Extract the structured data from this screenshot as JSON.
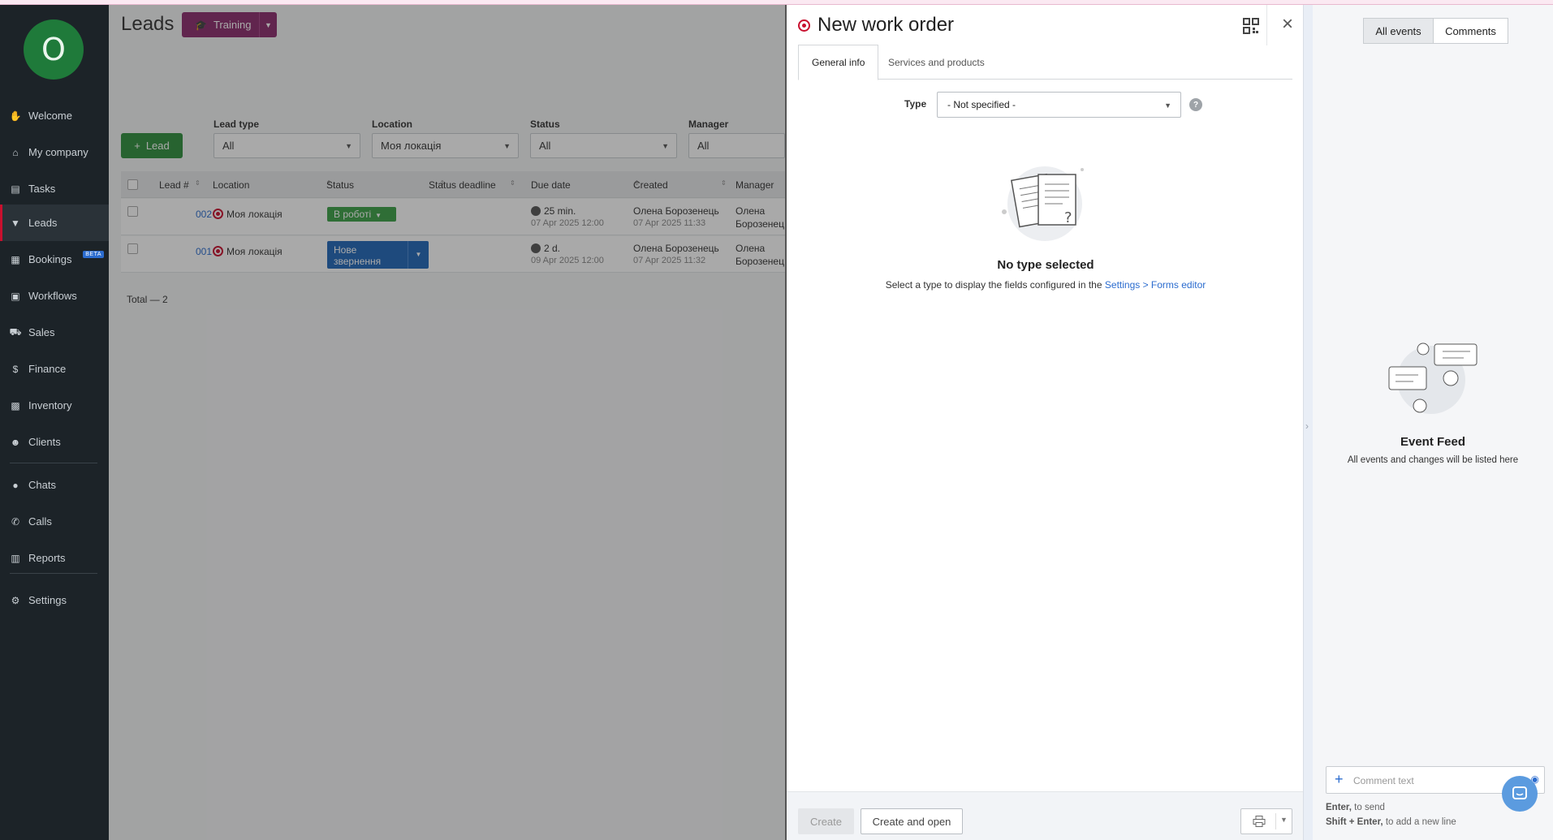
{
  "sidebar": {
    "avatar_letter": "O",
    "items": [
      {
        "label": "Welcome",
        "icon": "wave-hand-icon"
      },
      {
        "label": "My company",
        "icon": "home-icon"
      },
      {
        "label": "Tasks",
        "icon": "clipboard-icon"
      },
      {
        "label": "Leads",
        "icon": "funnel-icon"
      },
      {
        "label": "Bookings",
        "icon": "calendar-icon",
        "badge": "BETA"
      },
      {
        "label": "Workflows",
        "icon": "board-icon"
      },
      {
        "label": "Sales",
        "icon": "cart-icon"
      },
      {
        "label": "Finance",
        "icon": "dollar-icon"
      },
      {
        "label": "Inventory",
        "icon": "boxes-icon"
      },
      {
        "label": "Clients",
        "icon": "users-icon"
      },
      {
        "label": "Chats",
        "icon": "chat-icon"
      },
      {
        "label": "Calls",
        "icon": "phone-icon"
      },
      {
        "label": "Reports",
        "icon": "report-icon"
      },
      {
        "label": "Settings",
        "icon": "gear-icon"
      }
    ]
  },
  "leads": {
    "title": "Leads",
    "training_label": "Training",
    "add_lead_label": "Lead",
    "filters": [
      {
        "label": "Lead type",
        "value": "All"
      },
      {
        "label": "Location",
        "value": "Моя локація"
      },
      {
        "label": "Status",
        "value": "All"
      },
      {
        "label": "Manager",
        "value": "All"
      }
    ],
    "columns": [
      "Lead #",
      "Location",
      "Status",
      "Status deadline",
      "Due date",
      "Created",
      "Manager"
    ],
    "rows": [
      {
        "number": "002",
        "location": "Моя локація",
        "status": "В роботі",
        "status_color": "#3aa046",
        "due": "25 min.",
        "due_date": "07 Apr 2025 12:00",
        "created_by": "Олена Борозенець",
        "created_date": "07 Apr 2025 11:33",
        "manager_1": "Олена",
        "manager_2": "Борозенец"
      },
      {
        "number": "001",
        "location": "Моя локація",
        "status": "Нове звернення",
        "status_color": "#1f66b8",
        "due": "2 d.",
        "due_date": "09 Apr 2025 12:00",
        "created_by": "Олена Борозенець",
        "created_date": "07 Apr 2025 11:32",
        "manager_1": "Олена",
        "manager_2": "Борозенец"
      }
    ],
    "total": "Total — 2"
  },
  "panel": {
    "title": "New work order",
    "tabs": [
      "General info",
      "Services and products"
    ],
    "type_label": "Type",
    "type_value": "- Not specified -",
    "empty_title": "No type selected",
    "empty_text": "Select a type to display the fields configured in the",
    "empty_link": "Settings > Forms editor",
    "create_label": "Create",
    "create_open_label": "Create and open"
  },
  "feed": {
    "tabs": [
      "All events",
      "Comments"
    ],
    "title": "Event Feed",
    "subtitle": "All events and changes will be listed here",
    "comment_placeholder": "Comment text",
    "hint_enter_key": "Enter,",
    "hint_enter_text": " to send",
    "hint_shift_key": "Shift + Enter,",
    "hint_shift_text": " to add a new line"
  },
  "colors": {
    "sidebar_bg": "#1c2328",
    "accent_red": "#c8102e",
    "training_purple": "#8c2a6c",
    "add_green": "#2e8f3d",
    "link_blue": "#2b6ccf"
  }
}
